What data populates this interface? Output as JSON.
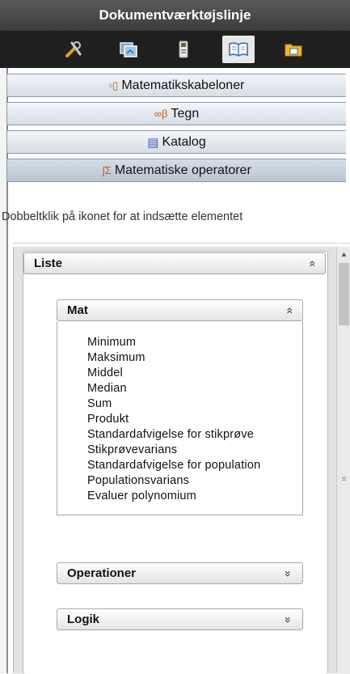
{
  "window": {
    "title": "Dokumentværktøjslinje"
  },
  "toolbar": {
    "buttons": [
      {
        "icon": "tools-icon"
      },
      {
        "icon": "document-pages-icon"
      },
      {
        "icon": "variables-icon"
      },
      {
        "icon": "utilities-book-icon",
        "active": true
      },
      {
        "icon": "content-explorer-icon"
      }
    ]
  },
  "accordions": [
    {
      "label": "Matematikskabeloner",
      "icon": "templates-icon"
    },
    {
      "label": "Tegn",
      "icon": "symbols-icon"
    },
    {
      "label": "Katalog",
      "icon": "catalog-icon"
    },
    {
      "label": "Matematiske operatorer",
      "icon": "operators-icon",
      "icon_glyph": "∫Σ",
      "active": true
    }
  ],
  "hint": "Dobbeltklik på ikonet for at indsætte elementet",
  "liste": {
    "title": "Liste",
    "sections": [
      {
        "title": "Mat",
        "expanded": true,
        "items": [
          "Minimum",
          "Maksimum",
          "Middel",
          "Median",
          "Sum",
          "Produkt",
          "Standardafvigelse for stikprøve",
          "Stikprøvevarians",
          "Standardafvigelse for population",
          "Populationsvarians",
          "Evaluer polynomium"
        ]
      },
      {
        "title": "Operationer",
        "expanded": false
      },
      {
        "title": "Logik",
        "expanded": false
      }
    ]
  },
  "glyphs": {
    "collapse": "»",
    "expand": "»"
  }
}
